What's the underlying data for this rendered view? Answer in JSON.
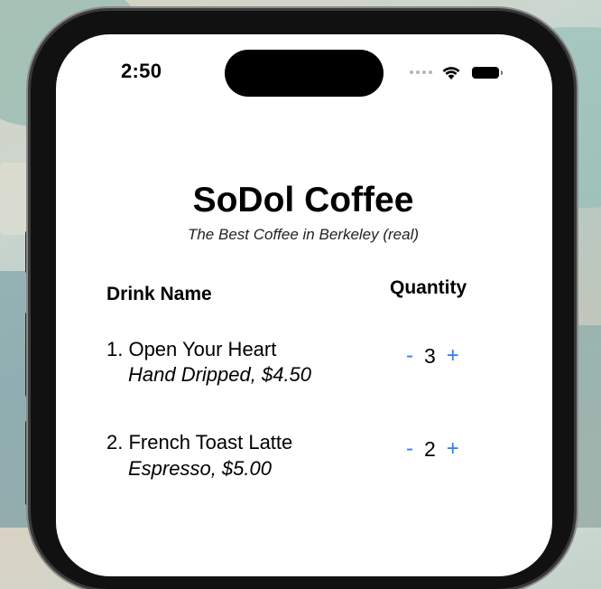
{
  "status_bar": {
    "time": "2:50"
  },
  "header": {
    "title": "SoDol Coffee",
    "subtitle": "The Best Coffee in Berkeley (real)"
  },
  "columns": {
    "drink_name": "Drink Name",
    "quantity": "Quantity"
  },
  "items": [
    {
      "name": "1. Open Your Heart",
      "detail": "Hand Dripped, $4.50",
      "quantity": "3",
      "decrement": "-",
      "increment": "+"
    },
    {
      "name": "2. French Toast Latte",
      "detail": "Espresso, $5.00",
      "quantity": "2",
      "decrement": "-",
      "increment": "+"
    }
  ],
  "colors": {
    "accent": "#2f7cf6",
    "text": "#000000",
    "background": "#ffffff"
  }
}
